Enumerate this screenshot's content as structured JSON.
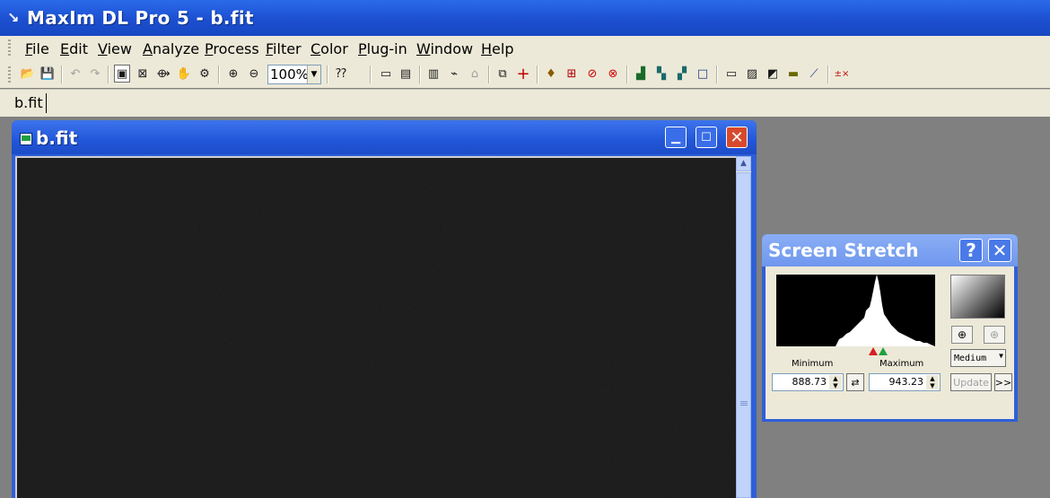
{
  "app": {
    "title": "MaxIm DL Pro 5 - b.fit"
  },
  "menu": [
    {
      "label": "File"
    },
    {
      "label": "Edit"
    },
    {
      "label": "View"
    },
    {
      "label": "Analyze"
    },
    {
      "label": "Process"
    },
    {
      "label": "Filter"
    },
    {
      "label": "Color"
    },
    {
      "label": "Plug-in"
    },
    {
      "label": "Window"
    },
    {
      "label": "Help"
    }
  ],
  "toolbar": {
    "zoom_value": "100%"
  },
  "tabs": [
    {
      "label": "b.fit"
    }
  ],
  "image_window": {
    "title": "b.fit"
  },
  "screen_stretch": {
    "title": "Screen Stretch",
    "help_label": "?",
    "minimum_label": "Minimum",
    "maximum_label": "Maximum",
    "minimum_value": "888.73",
    "maximum_value": "943.23",
    "preset_value": "Medium",
    "update_label": "Update",
    "more_label": ">>"
  }
}
